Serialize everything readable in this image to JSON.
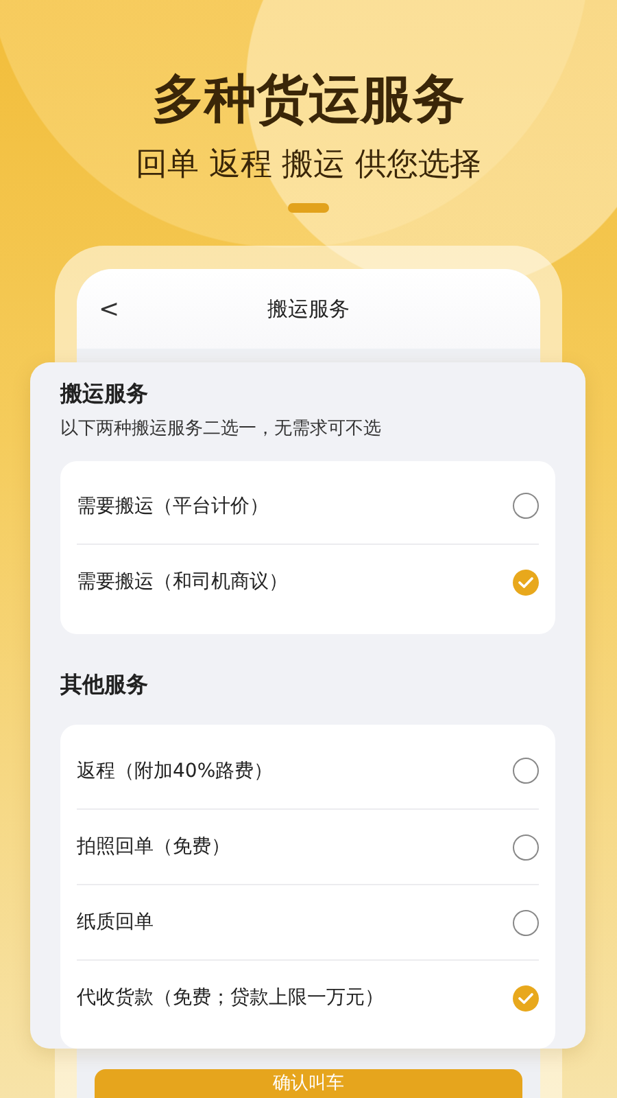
{
  "hero": {
    "title": "多种货运服务",
    "subtitle": "回单 返程 搬运 供您选择"
  },
  "screen": {
    "title": "搬运服务",
    "back": "<"
  },
  "sections": [
    {
      "title": "搬运服务",
      "hint": "以下两种搬运服务二选一，无需求可不选",
      "options": [
        {
          "label": "需要搬运（平台计价）",
          "selected": false
        },
        {
          "label": "需要搬运（和司机商议）",
          "selected": true
        }
      ]
    },
    {
      "title": "其他服务",
      "options": [
        {
          "label": "返程（附加40%路费）",
          "selected": false
        },
        {
          "label": "拍照回单（免费）",
          "selected": false
        },
        {
          "label": "纸质回单",
          "selected": false
        },
        {
          "label": "代收货款（免费；贷款上限一万元）",
          "selected": true
        }
      ]
    }
  ],
  "confirm": "确认叫车"
}
